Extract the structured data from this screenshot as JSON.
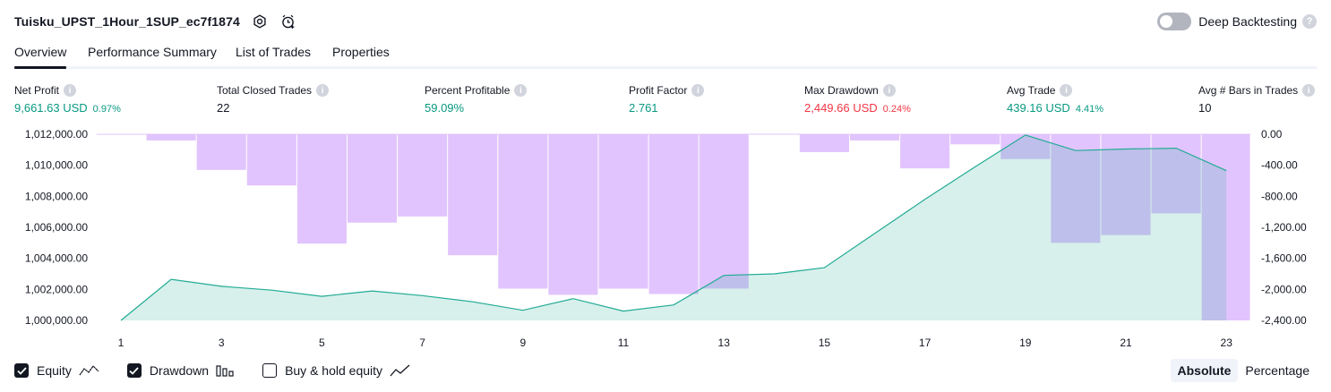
{
  "header": {
    "strategy_name": "Tuisku_UPST_1Hour_1SUP_ec7f1874",
    "settings_icon": "gear-icon",
    "alert_icon": "add-alert-icon",
    "deep_backtesting_label": "Deep Backtesting",
    "deep_backtesting_enabled": false,
    "help_icon": "question-icon"
  },
  "tabs": [
    {
      "label": "Overview",
      "active": true
    },
    {
      "label": "Performance Summary",
      "active": false
    },
    {
      "label": "List of Trades",
      "active": false
    },
    {
      "label": "Properties",
      "active": false
    }
  ],
  "metrics": [
    {
      "label": "Net Profit",
      "value": "9,661.63 USD",
      "pct": "0.97%",
      "color": "green"
    },
    {
      "label": "Total Closed Trades",
      "value": "22",
      "pct": "",
      "color": "dark"
    },
    {
      "label": "Percent Profitable",
      "value": "59.09%",
      "pct": "",
      "color": "green"
    },
    {
      "label": "Profit Factor",
      "value": "2.761",
      "pct": "",
      "color": "green"
    },
    {
      "label": "Max Drawdown",
      "value": "2,449.66 USD",
      "pct": "0.24%",
      "color": "red"
    },
    {
      "label": "Avg Trade",
      "value": "439.16 USD",
      "pct": "4.41%",
      "color": "green"
    },
    {
      "label": "Avg # Bars in Trades",
      "value": "10",
      "pct": "",
      "color": "dark"
    }
  ],
  "chart_data": {
    "type": "line",
    "x": [
      1,
      2,
      3,
      4,
      5,
      6,
      7,
      8,
      9,
      10,
      11,
      12,
      13,
      14,
      15,
      16,
      17,
      18,
      19,
      20,
      21,
      22,
      23
    ],
    "x_ticks": [
      1,
      3,
      5,
      7,
      9,
      11,
      13,
      15,
      17,
      19,
      21,
      23
    ],
    "left_axis": {
      "ticks": [
        "1,012,000.00",
        "1,010,000.00",
        "1,008,000.00",
        "1,006,000.00",
        "1,004,000.00",
        "1,002,000.00",
        "1,000,000.00"
      ],
      "ylim": [
        1000000,
        1012000
      ]
    },
    "right_axis": {
      "ticks": [
        "0.00",
        "-400.00",
        "-800.00",
        "-1,200.00",
        "-1,600.00",
        "-2,000.00",
        "-2,400.00"
      ],
      "ylim": [
        -2400,
        0
      ]
    },
    "series": [
      {
        "name": "Equity",
        "color": "#22ab94",
        "values": [
          1000000,
          1002650,
          1002200,
          1001950,
          1001550,
          1001900,
          1001600,
          1001200,
          1000650,
          1001400,
          1000600,
          1001000,
          1002900,
          1003000,
          1003400,
          1005600,
          1007800,
          1009900,
          1011950,
          1010950,
          1011050,
          1011100,
          1009650
        ]
      },
      {
        "name": "Drawdown",
        "color": "#e1c4fd",
        "values": [
          -5,
          -80,
          -460,
          -660,
          -1410,
          -1140,
          -1060,
          -1560,
          -1990,
          -2070,
          -1990,
          -2060,
          -1990,
          0,
          -230,
          -80,
          -440,
          -130,
          -320,
          -1400,
          -1300,
          -1020,
          -2400
        ]
      }
    ]
  },
  "legend": [
    {
      "label": "Equity",
      "checked": true,
      "icon": "equity-line-icon"
    },
    {
      "label": "Drawdown",
      "checked": true,
      "icon": "drawdown-bars-icon"
    },
    {
      "label": "Buy & hold equity",
      "checked": false,
      "icon": "buy-hold-line-icon"
    }
  ],
  "modes": [
    {
      "label": "Absolute",
      "active": true
    },
    {
      "label": "Percentage",
      "active": false
    }
  ],
  "colors": {
    "green": "#089981",
    "red": "#f23645",
    "equity_line": "#22ab94",
    "equity_fill": "#e0f4ef",
    "drawdown_fill": "#e1c4fd"
  }
}
